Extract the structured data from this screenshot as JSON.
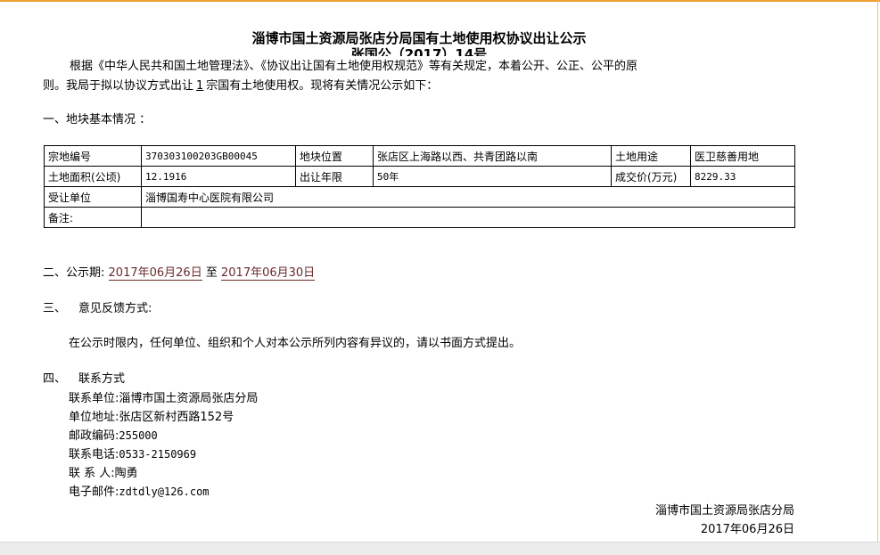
{
  "title": "淄博市国土资源局张店分局国有土地使用权协议出让公示",
  "subtitle": "张国公（2017）14号",
  "intro": {
    "part1": "根据《中华人民共和国土地管理法》、《协议出让国有土地使用权规范》等有关规定，本着公开、公正、公平的原则。我局于拟以协议方式出让",
    "count": "1",
    "part2": "宗国有土地使用权。现将有关情况公示如下："
  },
  "section1": "一、地块基本情况 ：",
  "table": {
    "r1": [
      "宗地编号",
      "370303100203GB00045",
      "地块位置",
      "张店区上海路以西、共青团路以南",
      "土地用途",
      "医卫慈善用地"
    ],
    "r2": [
      "土地面积(公顷)",
      "12.1916",
      "出让年限",
      "50年",
      "成交价(万元)",
      "8229.33"
    ],
    "r3": [
      "受让单位",
      "淄博国寿中心医院有限公司"
    ],
    "r4": [
      "备注:",
      ""
    ]
  },
  "section2": {
    "label": "二、公示期:",
    "start": "2017年06月26日",
    "to": "至",
    "end": "2017年06月30日"
  },
  "section3": {
    "num": "三、",
    "label": "意见反馈方式:"
  },
  "notice": "在公示时限内，任何单位、组织和个人对本公示所列内容有异议的，请以书面方式提出。",
  "section4": {
    "num": "四、",
    "label": "联系方式"
  },
  "contacts": [
    {
      "label": "联系单位:",
      "value": "淄博市国土资源局张店分局"
    },
    {
      "label": "单位地址:",
      "value": "张店区新村西路152号"
    },
    {
      "label": "邮政编码:",
      "value": "255000"
    },
    {
      "label": "联系电话:",
      "value": "0533-2150969"
    },
    {
      "label": "联 系 人:",
      "value": "陶勇"
    },
    {
      "label": "电子邮件:",
      "value": "zdtdly@126.com"
    }
  ],
  "signature": {
    "org": "淄博市国土资源局张店分局",
    "date": "2017年06月26日"
  },
  "colors": {
    "top_bar": "#f0a030",
    "date_text": "#6a2a2a"
  }
}
